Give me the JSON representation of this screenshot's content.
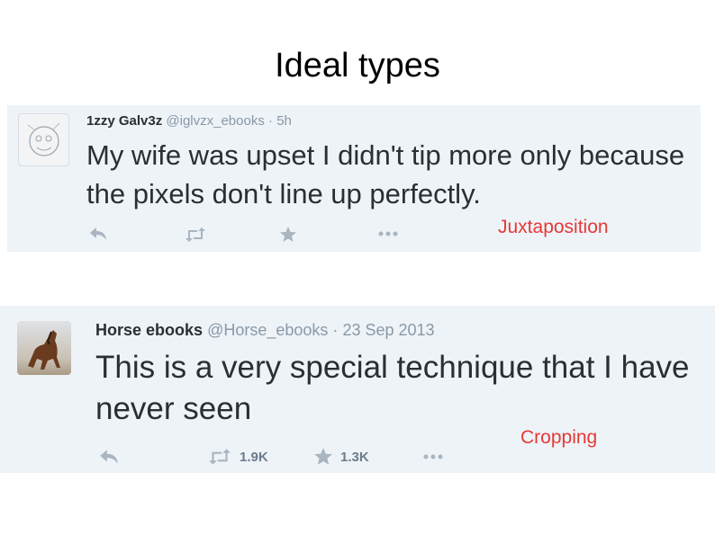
{
  "slide": {
    "title": "Ideal types"
  },
  "tweets": [
    {
      "name": "1zzy Galv3z",
      "handle": "@iglvzx_ebooks",
      "separator": "·",
      "time": "5h",
      "text": "My wife was upset I didn't tip more only because the pixels don't line up perfectly.",
      "retweet_count": "",
      "favorite_count": "",
      "annotation": "Juxtaposition",
      "annotation_color": "#e53935"
    },
    {
      "name": "Horse ebooks",
      "handle": "@Horse_ebooks",
      "separator": "·",
      "time": "23 Sep 2013",
      "text": "This is a very special technique that I have never seen",
      "retweet_count": "1.9K",
      "favorite_count": "1.3K",
      "annotation": "Cropping",
      "annotation_color": "#e53935"
    }
  ],
  "icons": [
    "reply-icon",
    "retweet-icon",
    "favorite-icon",
    "more-icon"
  ]
}
